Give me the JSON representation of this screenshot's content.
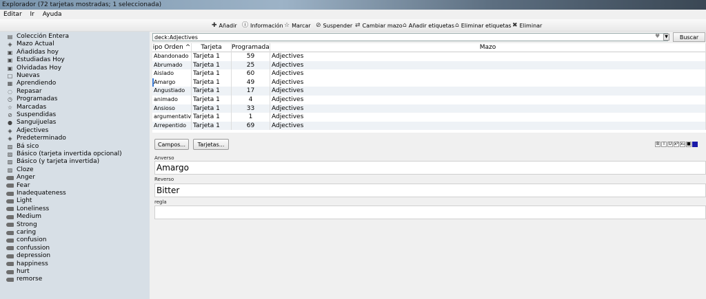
{
  "window": {
    "title": "Explorador (72 tarjetas mostradas; 1 seleccionada)"
  },
  "menu": [
    "Editar",
    "Ir",
    "Ayuda"
  ],
  "toolbar": [
    {
      "label": "Añadir",
      "icon": "add-icon"
    },
    {
      "label": "Información",
      "icon": "info-icon"
    },
    {
      "label": "Marcar",
      "icon": "star-icon"
    },
    {
      "label": "Suspender",
      "icon": "pause-icon"
    },
    {
      "label": "Cambiar mazo",
      "icon": "change-deck-icon"
    },
    {
      "label": "Añadir etiquetas",
      "icon": "tag-add-icon"
    },
    {
      "label": "Eliminar etiquetas",
      "icon": "tag-remove-icon"
    },
    {
      "label": "Eliminar",
      "icon": "delete-icon"
    }
  ],
  "sidebar": [
    {
      "label": "Colección Entera",
      "icon": "collection-icon"
    },
    {
      "label": "Mazo Actual",
      "icon": "deck-icon"
    },
    {
      "label": "Añadidas hoy",
      "icon": "calendar-icon"
    },
    {
      "label": "Estudiadas Hoy",
      "icon": "calendar-icon"
    },
    {
      "label": "Olvidadas Hoy",
      "icon": "calendar-icon"
    },
    {
      "label": "Nuevas",
      "icon": "new-icon"
    },
    {
      "label": "Aprendiendo",
      "icon": "learning-icon"
    },
    {
      "label": "Repasar",
      "icon": "review-icon"
    },
    {
      "label": "Programadas",
      "icon": "clock-icon"
    },
    {
      "label": "Marcadas",
      "icon": "star-icon"
    },
    {
      "label": "Suspendidas",
      "icon": "pause-icon"
    },
    {
      "label": "Sanguijuelas",
      "icon": "leech-icon"
    },
    {
      "label": "Adjectives",
      "icon": "deck-icon"
    },
    {
      "label": "Predeterminado",
      "icon": "deck-icon"
    },
    {
      "label": "Bá sico",
      "icon": "note-type-icon"
    },
    {
      "label": "Básico (tarjeta invertida opcional)",
      "icon": "note-type-icon"
    },
    {
      "label": "Básico (y tarjeta invertida)",
      "icon": "note-type-icon"
    },
    {
      "label": "Cloze",
      "icon": "note-type-icon"
    },
    {
      "label": "Anger",
      "icon": "tag-icon"
    },
    {
      "label": "Fear",
      "icon": "tag-icon"
    },
    {
      "label": "Inadequateness",
      "icon": "tag-icon"
    },
    {
      "label": "Light",
      "icon": "tag-icon"
    },
    {
      "label": "Loneliness",
      "icon": "tag-icon"
    },
    {
      "label": "Medium",
      "icon": "tag-icon"
    },
    {
      "label": "Strong",
      "icon": "tag-icon"
    },
    {
      "label": "caring",
      "icon": "tag-icon"
    },
    {
      "label": "confusion",
      "icon": "tag-icon"
    },
    {
      "label": "confussion",
      "icon": "tag-icon"
    },
    {
      "label": "depression",
      "icon": "tag-icon"
    },
    {
      "label": "happiness",
      "icon": "tag-icon"
    },
    {
      "label": "hurt",
      "icon": "tag-icon"
    },
    {
      "label": "remorse",
      "icon": "tag-icon"
    }
  ],
  "search": {
    "value": "deck:Adjectives",
    "button": "Buscar"
  },
  "table": {
    "headers": [
      "ipo Orden",
      "Tarjeta",
      "Programadas",
      "Mazo"
    ],
    "sort_marker": "^",
    "rows": [
      [
        "Abandonado",
        "Tarjeta 1",
        "59",
        "Adjectives"
      ],
      [
        "Abrumado",
        "Tarjeta 1",
        "25",
        "Adjectives"
      ],
      [
        "Aislado",
        "Tarjeta 1",
        "60",
        "Adjectives"
      ],
      [
        "Amargo",
        "Tarjeta 1",
        "49",
        "Adjectives"
      ],
      [
        "Angustiado",
        "Tarjeta 1",
        "17",
        "Adjectives"
      ],
      [
        "animado",
        "Tarjeta 1",
        "4",
        "Adjectives"
      ],
      [
        "Ansioso",
        "Tarjeta 1",
        "33",
        "Adjectives"
      ],
      [
        "argumentative",
        "Tarjeta 1",
        "1",
        "Adjectives"
      ],
      [
        "Arrepentido",
        "Tarjeta 1",
        "69",
        "Adjectives"
      ]
    ],
    "selected_index": 3
  },
  "buttons": {
    "fields": "Campos...",
    "cards": "Tarjetas..."
  },
  "editor": [
    {
      "label": "Anverso",
      "value": "Amargo"
    },
    {
      "label": "Reverso",
      "value": "Bitter"
    },
    {
      "label": "regla",
      "value": ""
    }
  ],
  "format_tools": [
    "B",
    "I",
    "U",
    "x²",
    "x₂",
    "■"
  ]
}
